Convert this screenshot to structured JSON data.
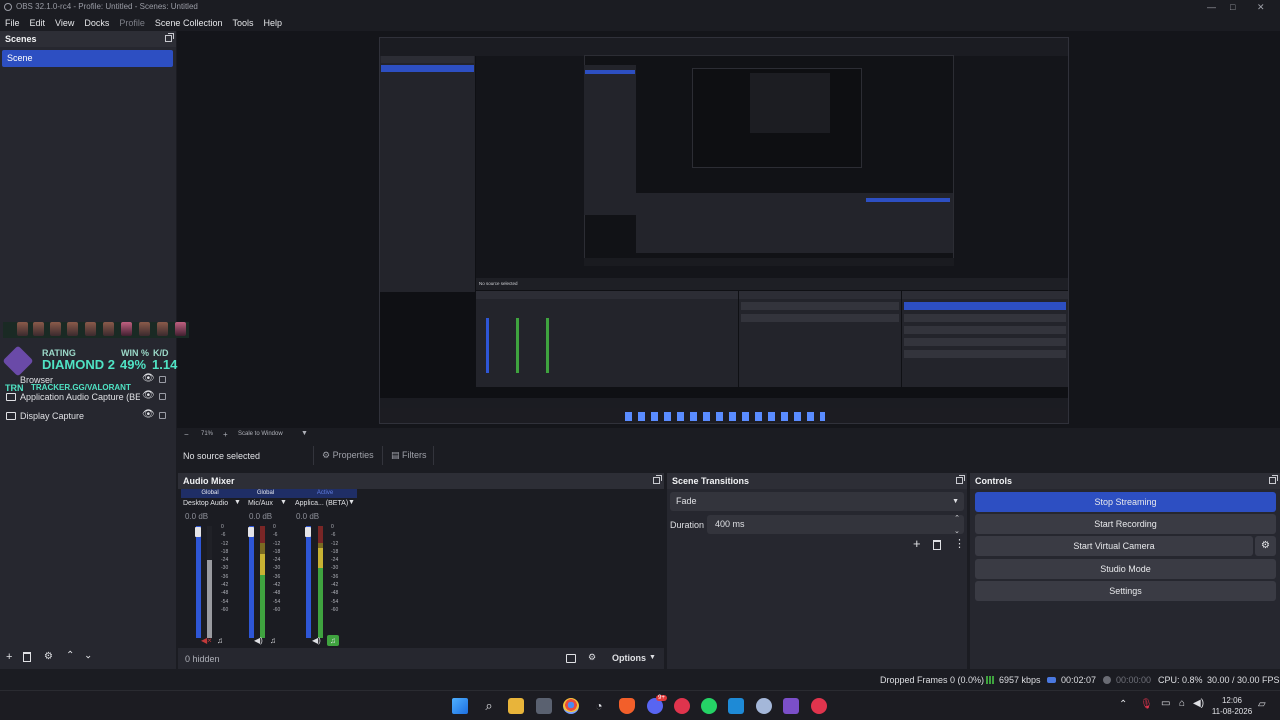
{
  "window": {
    "title": "OBS 32.1.0-rc4 - Profile: Untitled - Scenes: Untitled",
    "controls": [
      "—",
      "□",
      "✕"
    ]
  },
  "menu": [
    "File",
    "Edit",
    "View",
    "Docks",
    "Profile",
    "Scene Collection",
    "Tools",
    "Help"
  ],
  "scenes": {
    "title": "Scenes",
    "items": [
      "Scene"
    ],
    "selected": "Scene"
  },
  "overlay": {
    "rank_label": "RATING",
    "rank_value": "DIAMOND 2",
    "win_label": "WIN %",
    "win_value": "49%",
    "kd_label": "K/D",
    "kd_value": "1.14",
    "trn": "TRN",
    "url": "TRACKER.GG/VALORANT"
  },
  "sources": {
    "items": [
      {
        "name": "Browser"
      },
      {
        "name": "Application Audio Capture (BET"
      },
      {
        "name": "Display Capture"
      }
    ]
  },
  "preview_toolbar": {
    "zoom_minus": "−",
    "zoom": "71%",
    "zoom_plus": "+",
    "scale_mode": "Scale to Window"
  },
  "context_bar": {
    "no_source": "No source selected",
    "properties": "Properties",
    "filters": "Filters"
  },
  "audio_mixer": {
    "title": "Audio Mixer",
    "channels": [
      {
        "tag": "Global",
        "name": "Desktop Audio",
        "db": "0.0 dB",
        "level": 0.95
      },
      {
        "tag": "Global",
        "name": "Mic/Aux",
        "db": "0.0 dB",
        "level": 0.78
      },
      {
        "tag": "Active",
        "name": "Applica... (BETA)",
        "db": "0.0 dB",
        "level": 0.8
      }
    ],
    "scale": [
      "0",
      "-6",
      "-12",
      "-18",
      "-24",
      "-30",
      "-36",
      "-42",
      "-48",
      "-54",
      "-60"
    ],
    "hidden": "0 hidden",
    "options": "Options"
  },
  "transitions": {
    "title": "Scene Transitions",
    "selected": "Fade",
    "duration_label": "Duration",
    "duration_value": "400 ms"
  },
  "controls": {
    "title": "Controls",
    "stop_streaming": "Stop Streaming",
    "start_recording": "Start Recording",
    "start_virtual_camera": "Start Virtual Camera",
    "studio_mode": "Studio Mode",
    "settings": "Settings"
  },
  "status": {
    "dropped": "Dropped Frames 0 (0.0%)",
    "bitrate": "6957 kbps",
    "stream_time": "00:02:07",
    "rec_time": "00:00:00",
    "cpu": "CPU: 0.8%",
    "fps": "30.00 / 30.00 FPS"
  },
  "taskbar": {
    "time": "12:06",
    "date": "11-08-2026",
    "discord_badge": "9+"
  },
  "colors": {
    "accent": "#2d4fc2",
    "bg": "#1b1c22",
    "panel": "#26272f",
    "meter_green": "#3fa33f",
    "meter_yellow": "#c8b233",
    "meter_red": "#c23a3a"
  }
}
